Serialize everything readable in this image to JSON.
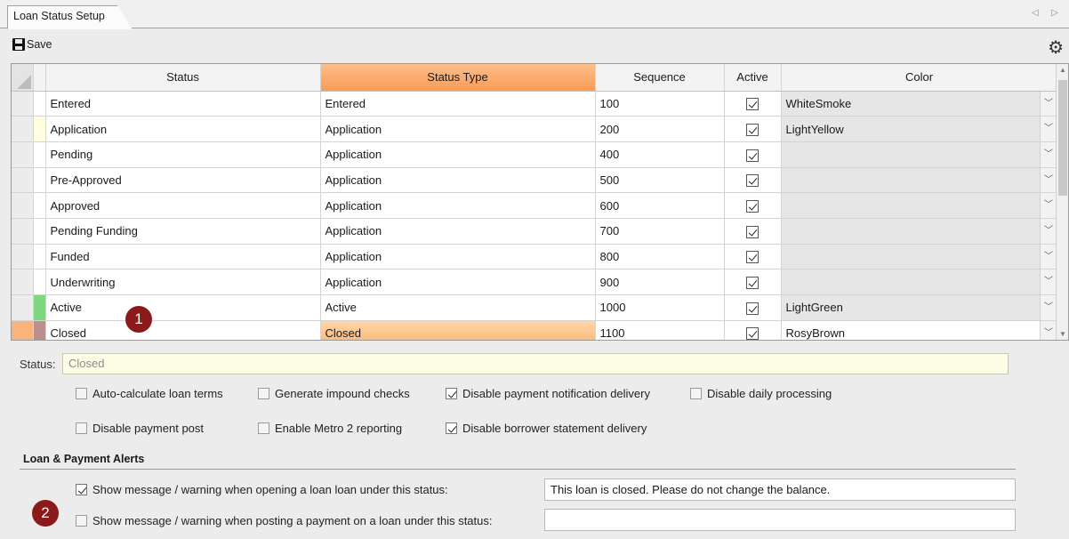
{
  "tab": {
    "title": "Loan Status Setup",
    "scroll_glyphs": "◁ ▷"
  },
  "toolbar": {
    "save_label": "Save"
  },
  "grid": {
    "columns": [
      "Status",
      "Status Type",
      "Sequence",
      "Active",
      "Color"
    ],
    "sorted_column": "Status Type",
    "rows": [
      {
        "status": "Entered",
        "type": "Entered",
        "sequence": "100",
        "active": true,
        "color": "WhiteSmoke",
        "swatch": "#ffffff"
      },
      {
        "status": "Application",
        "type": "Application",
        "sequence": "200",
        "active": true,
        "color": "LightYellow",
        "swatch": "#fffee0"
      },
      {
        "status": "Pending",
        "type": "Application",
        "sequence": "400",
        "active": true,
        "color": "",
        "swatch": "#ffffff"
      },
      {
        "status": "Pre-Approved",
        "type": "Application",
        "sequence": "500",
        "active": true,
        "color": "",
        "swatch": "#ffffff"
      },
      {
        "status": "Approved",
        "type": "Application",
        "sequence": "600",
        "active": true,
        "color": "",
        "swatch": "#ffffff"
      },
      {
        "status": "Pending Funding",
        "type": "Application",
        "sequence": "700",
        "active": true,
        "color": "",
        "swatch": "#ffffff"
      },
      {
        "status": "Funded",
        "type": "Application",
        "sequence": "800",
        "active": true,
        "color": "",
        "swatch": "#ffffff"
      },
      {
        "status": "Underwriting",
        "type": "Application",
        "sequence": "900",
        "active": true,
        "color": "",
        "swatch": "#ffffff"
      },
      {
        "status": "Active",
        "type": "Active",
        "sequence": "1000",
        "active": true,
        "color": "LightGreen",
        "swatch": "#7fd77f"
      },
      {
        "status": "Closed",
        "type": "Closed",
        "sequence": "1100",
        "active": true,
        "color": "RosyBrown",
        "swatch": "#bc8f8f"
      }
    ]
  },
  "badges": {
    "one": "1",
    "two": "2"
  },
  "details": {
    "status_label": "Status:",
    "status_value": "Closed",
    "options": {
      "auto_calc": {
        "label": "Auto-calculate loan terms",
        "checked": false
      },
      "gen_impound": {
        "label": "Generate impound checks",
        "checked": false
      },
      "disable_notif": {
        "label": "Disable payment notification delivery",
        "checked": true
      },
      "disable_daily": {
        "label": "Disable daily processing",
        "checked": false
      },
      "disable_post": {
        "label": "Disable payment post",
        "checked": false
      },
      "enable_metro": {
        "label": "Enable Metro 2 reporting",
        "checked": false
      },
      "disable_stmt": {
        "label": "Disable borrower statement delivery",
        "checked": true
      }
    }
  },
  "alerts": {
    "section_title": "Loan & Payment Alerts",
    "open_label": "Show message / warning when opening a loan loan under this status:",
    "open_checked": true,
    "open_message": "This loan is closed. Please do not change the balance.",
    "post_label": "Show message / warning when posting a payment on a loan under this status:",
    "post_checked": false,
    "post_message": ""
  }
}
